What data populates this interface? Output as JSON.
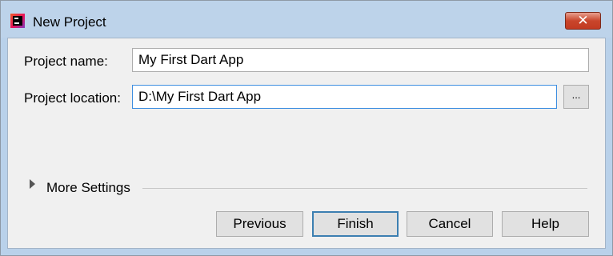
{
  "window": {
    "title": "New Project",
    "close_label": "✕"
  },
  "form": {
    "project_name": {
      "label": "Project name:",
      "value": "My First Dart App"
    },
    "project_location": {
      "label": "Project location:",
      "value": "D:\\My First Dart App",
      "browse_label": "..."
    }
  },
  "more_settings": {
    "label": "More Settings"
  },
  "buttons": {
    "previous": "Previous",
    "finish": "Finish",
    "cancel": "Cancel",
    "help": "Help"
  }
}
